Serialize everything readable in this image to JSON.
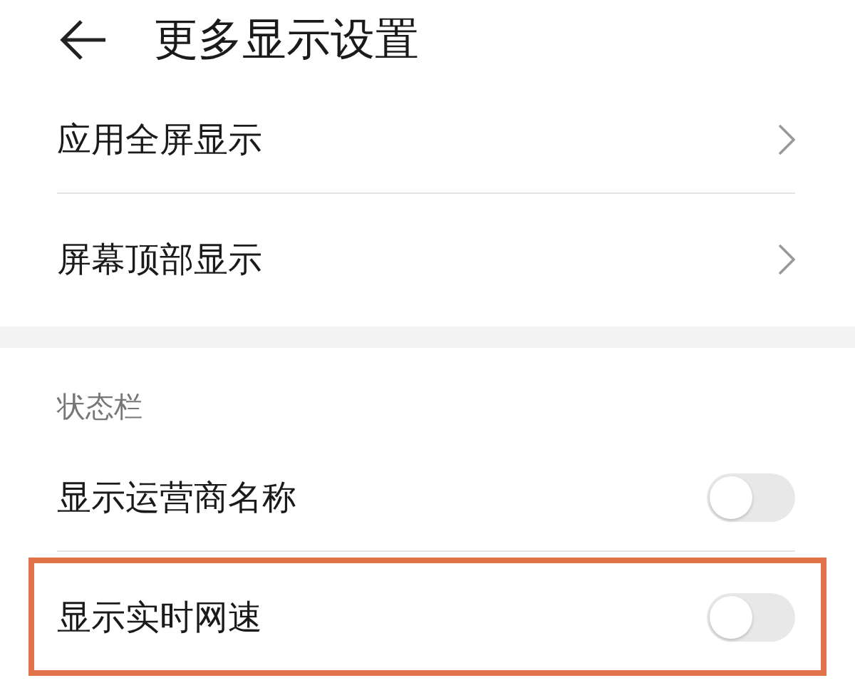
{
  "header": {
    "title": "更多显示设置"
  },
  "groups": [
    {
      "items": [
        {
          "label": "应用全屏显示",
          "kind": "link",
          "highlighted": false
        },
        {
          "label": "屏幕顶部显示",
          "kind": "link",
          "highlighted": false
        }
      ]
    },
    {
      "section": "状态栏",
      "items": [
        {
          "label": "显示运营商名称",
          "kind": "toggle",
          "on": false,
          "highlighted": false
        },
        {
          "label": "显示实时网速",
          "kind": "toggle",
          "on": false,
          "highlighted": true
        }
      ]
    }
  ]
}
